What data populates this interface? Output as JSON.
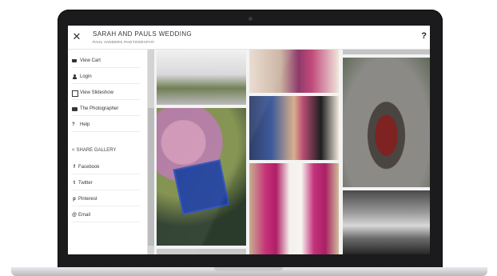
{
  "header": {
    "title": "SARAH AND PAULS WEDDING",
    "subtitle": "PAUL VANDERS PHOTOGRAPHY",
    "close_icon": "close-icon",
    "help_icon": "help-icon"
  },
  "sidebar": {
    "items": [
      {
        "label": "View Cart",
        "icon": "cart-icon"
      },
      {
        "label": "Login",
        "icon": "user-icon"
      },
      {
        "label": "View Slideshow",
        "icon": "slideshow-icon"
      },
      {
        "label": "The Photographer",
        "icon": "camera-icon"
      },
      {
        "label": "Help",
        "icon": "question-icon"
      }
    ],
    "share_heading": "SHARE GALLERY",
    "share_items": [
      {
        "label": "Facebook",
        "glyph": "f"
      },
      {
        "label": "Twitter",
        "glyph": "t"
      },
      {
        "label": "Pinterest",
        "glyph": "p"
      },
      {
        "label": "Email",
        "glyph": "@"
      }
    ]
  },
  "gallery": {
    "photos": [
      "bouquet-photo",
      "bridesmaids-makeup-photo",
      "church-doorway-photo",
      "earrings-box-photo",
      "bride-getting-ready-photo",
      "bride-with-bridesmaids-photo",
      "church-interior-bw-photo"
    ]
  },
  "colors": {
    "bezel": "#1b1b1d",
    "screen_bg": "#f3f3f3",
    "text": "#333333"
  }
}
